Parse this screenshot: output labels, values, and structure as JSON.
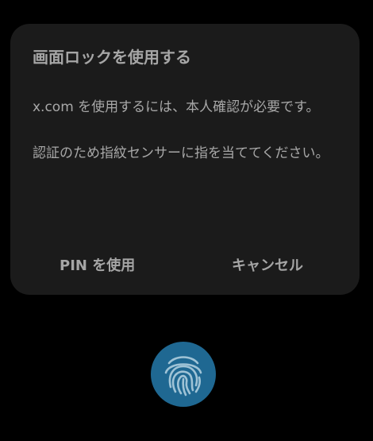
{
  "dialog": {
    "title": "画面ロックを使用する",
    "body_line1": "x.com を使用するには、本人確認が必要です。",
    "body_line2": "認証のため指紋センサーに指を当ててください。",
    "pin_button_label": "PIN を使用",
    "cancel_button_label": "キャンセル"
  },
  "fingerprint": {
    "icon": "fingerprint-icon",
    "background_color": "#1f6892",
    "stroke_color": "#9fc3d6"
  },
  "colors": {
    "screen_background": "#000000",
    "dialog_background": "#1b1b1b",
    "text": "#a6a6a6"
  }
}
